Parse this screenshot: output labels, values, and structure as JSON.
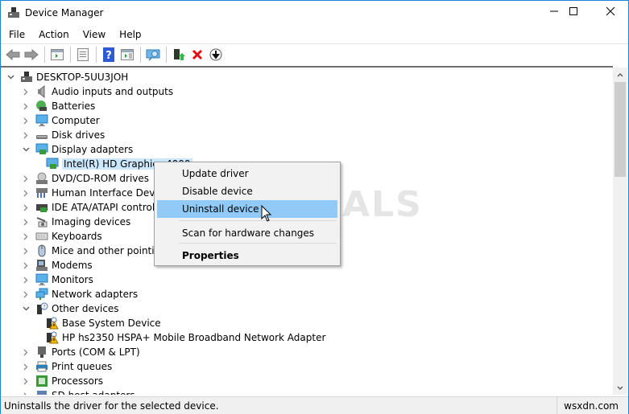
{
  "window": {
    "title": "Device Manager",
    "controls": {
      "minimize": "—",
      "maximize": "☐",
      "close": "✕"
    }
  },
  "menu": [
    "File",
    "Action",
    "View",
    "Help"
  ],
  "toolbar": [
    "back",
    "forward",
    "show-hide-console-tree",
    "properties",
    "help",
    "action-pane",
    "scan-hardware",
    "update-driver",
    "uninstall",
    "disable"
  ],
  "tree": {
    "root": "DESKTOP-5UU3JOH",
    "items": [
      {
        "label": "Audio inputs and outputs",
        "level": 1,
        "state": "collapsed",
        "icon": "speaker"
      },
      {
        "label": "Batteries",
        "level": 1,
        "state": "collapsed",
        "icon": "battery"
      },
      {
        "label": "Computer",
        "level": 1,
        "state": "collapsed",
        "icon": "monitor"
      },
      {
        "label": "Disk drives",
        "level": 1,
        "state": "collapsed",
        "icon": "disk"
      },
      {
        "label": "Display adapters",
        "level": 1,
        "state": "expanded",
        "icon": "display-adapter"
      },
      {
        "label": "Intel(R) HD Graphics 4000",
        "level": 2,
        "state": "leaf",
        "icon": "display-adapter",
        "selected": true
      },
      {
        "label": "DVD/CD-ROM drives",
        "level": 1,
        "state": "collapsed",
        "icon": "dvd"
      },
      {
        "label": "Human Interface Devices",
        "level": 1,
        "state": "collapsed",
        "icon": "hid"
      },
      {
        "label": "IDE ATA/ATAPI controllers",
        "level": 1,
        "state": "collapsed",
        "icon": "ide"
      },
      {
        "label": "Imaging devices",
        "level": 1,
        "state": "collapsed",
        "icon": "camera"
      },
      {
        "label": "Keyboards",
        "level": 1,
        "state": "collapsed",
        "icon": "keyboard"
      },
      {
        "label": "Mice and other pointing devices",
        "level": 1,
        "state": "collapsed",
        "icon": "mouse"
      },
      {
        "label": "Modems",
        "level": 1,
        "state": "collapsed",
        "icon": "modem"
      },
      {
        "label": "Monitors",
        "level": 1,
        "state": "collapsed",
        "icon": "monitor"
      },
      {
        "label": "Network adapters",
        "level": 1,
        "state": "collapsed",
        "icon": "network"
      },
      {
        "label": "Other devices",
        "level": 1,
        "state": "expanded",
        "icon": "unknown"
      },
      {
        "label": "Base System Device",
        "level": 2,
        "state": "leaf",
        "icon": "warning-device"
      },
      {
        "label": "HP hs2350 HSPA+ Mobile Broadband Network Adapter",
        "level": 2,
        "state": "leaf",
        "icon": "warning-device"
      },
      {
        "label": "Ports (COM & LPT)",
        "level": 1,
        "state": "collapsed",
        "icon": "port"
      },
      {
        "label": "Print queues",
        "level": 1,
        "state": "collapsed",
        "icon": "printer"
      },
      {
        "label": "Processors",
        "level": 1,
        "state": "collapsed",
        "icon": "cpu"
      },
      {
        "label": "SD host adapters",
        "level": 1,
        "state": "collapsed",
        "icon": "sd"
      }
    ]
  },
  "context_menu": {
    "items": [
      {
        "label": "Update driver"
      },
      {
        "label": "Disable device"
      },
      {
        "label": "Uninstall device",
        "highlighted": true
      },
      {
        "label": "Scan for hardware changes"
      },
      {
        "label": "Properties",
        "bold": true
      }
    ]
  },
  "status": {
    "text": "Uninstalls the driver for the selected device.",
    "watermark": "wsxdn.com"
  },
  "overlay_watermark": "A PUALS"
}
